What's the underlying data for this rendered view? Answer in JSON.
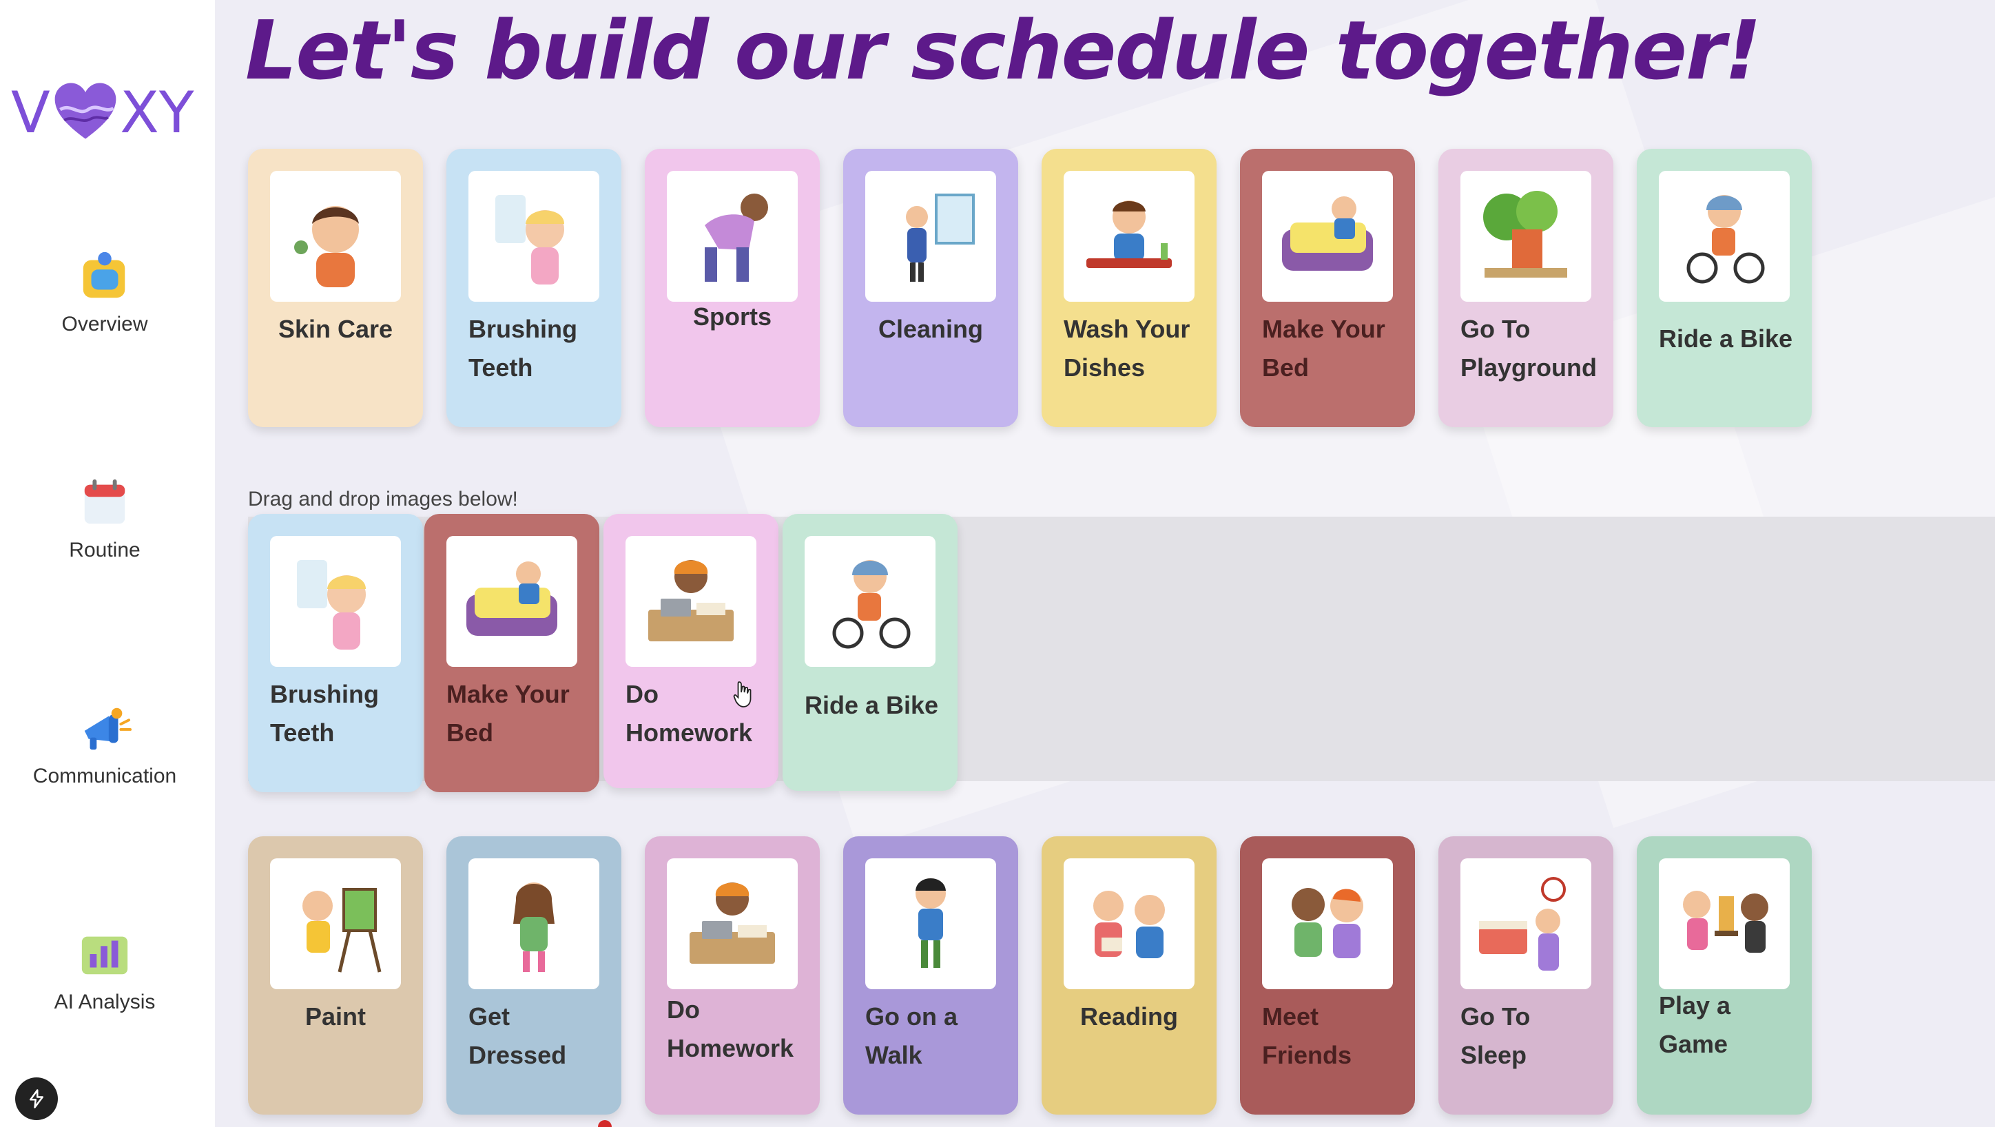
{
  "app": {
    "logo_text": "VOXY",
    "title": "Let's build our schedule together!"
  },
  "sidebar": {
    "items": [
      {
        "label": "Overview",
        "icon": "overview-icon"
      },
      {
        "label": "Routine",
        "icon": "calendar-icon"
      },
      {
        "label": "Communication",
        "icon": "megaphone-icon"
      },
      {
        "label": "AI Analysis",
        "icon": "chart-icon"
      }
    ]
  },
  "top_cards": [
    {
      "label": "Skin Care",
      "color": "#f7e3c6"
    },
    {
      "label": "Brushing Teeth",
      "color": "#c7e2f4"
    },
    {
      "label": "Sports",
      "color": "#f1c6ec"
    },
    {
      "label": "Cleaning",
      "color": "#c3b5ee"
    },
    {
      "label": "Wash Your Dishes",
      "color": "#f4df8e"
    },
    {
      "label": "Make Your Bed",
      "color": "#bb6f6d"
    },
    {
      "label": "Go To Playground",
      "color": "#e9cde3"
    },
    {
      "label": "Ride a Bike",
      "color": "#c5e7d6"
    }
  ],
  "drop_hint": "Drag and drop images below!",
  "schedule_cards": [
    {
      "label": "Brushing Teeth",
      "color": "#c7e2f4"
    },
    {
      "label": "Make Your Bed",
      "color": "#bb6f6d"
    },
    {
      "label": "Do Homework",
      "color": "#f1c6ec"
    },
    {
      "label": "Ride a Bike",
      "color": "#c5e7d6"
    }
  ],
  "bottom_cards": [
    {
      "label": "Paint",
      "color": "#dcc8ad"
    },
    {
      "label": "Get Dressed",
      "color": "#aac5d8"
    },
    {
      "label": "Do Homework",
      "color": "#deb3d6"
    },
    {
      "label": "Go on a Walk",
      "color": "#a998d9"
    },
    {
      "label": "Reading",
      "color": "#e6cd80"
    },
    {
      "label": "Meet Friends",
      "color": "#a95b5a"
    },
    {
      "label": "Go To Sleep",
      "color": "#d6b6cf"
    },
    {
      "label": "Play a Game",
      "color": "#aed7c2"
    }
  ]
}
